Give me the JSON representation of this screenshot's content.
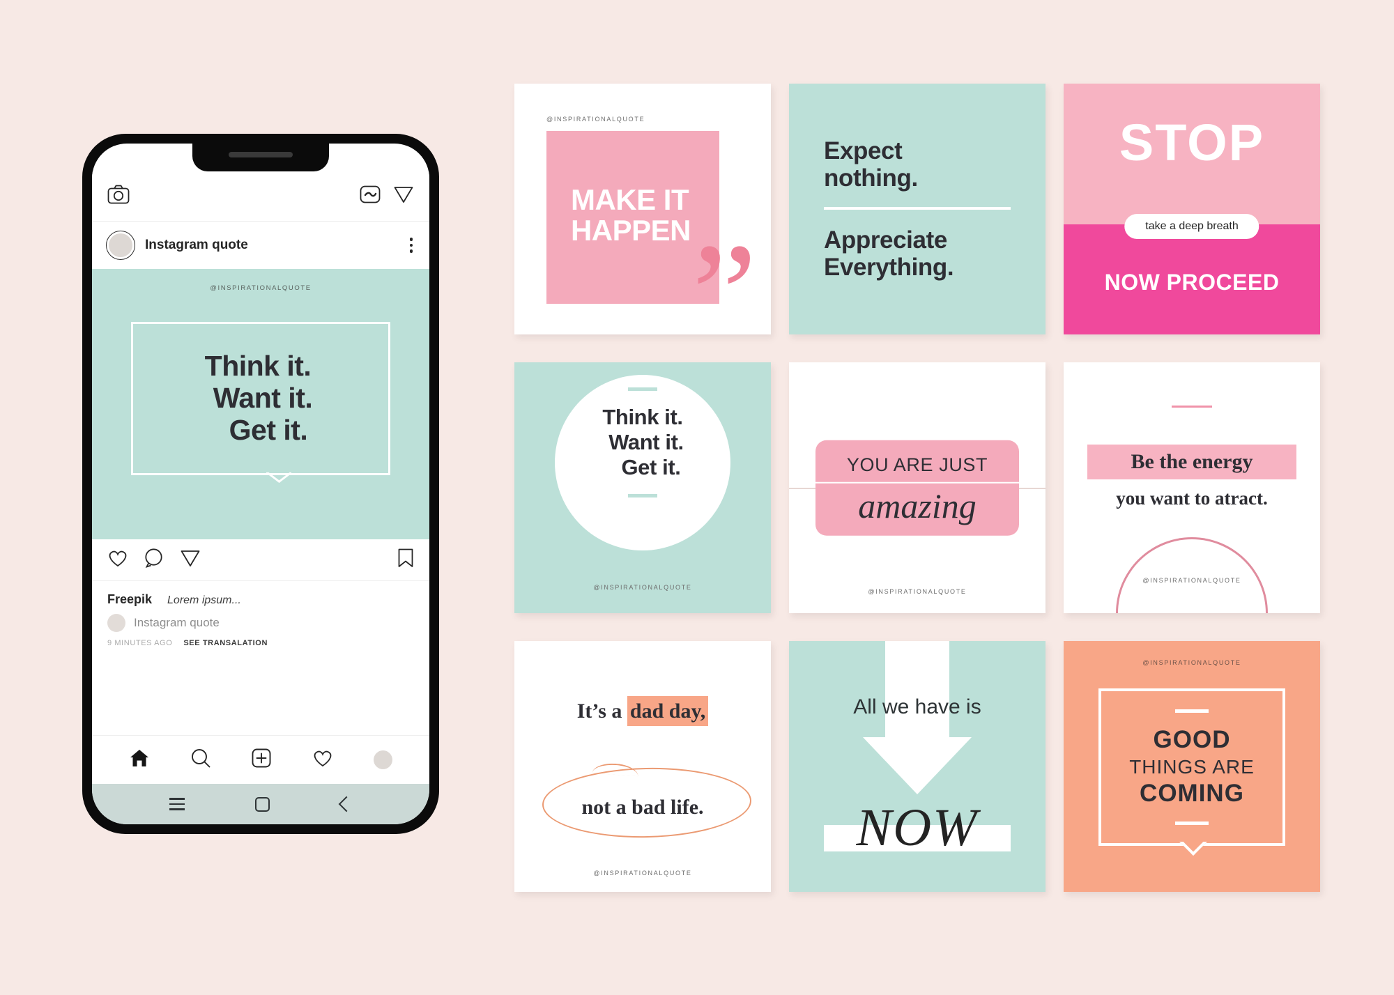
{
  "phone": {
    "topbar": {
      "camera_icon": "camera-icon",
      "igtv_icon": "igtv-icon",
      "send_icon": "send-icon"
    },
    "post_header": {
      "username": "Instagram quote",
      "more_icon": "more-options-icon"
    },
    "media": {
      "handle": "@INSPIRATIONALQUOTE",
      "quote_line1": "Think it.",
      "quote_line2": "Want it.",
      "quote_line3": "Get it.",
      "background_color": "#BCE0D8"
    },
    "actions": {
      "like_icon": "heart-icon",
      "comment_icon": "comment-icon",
      "share_icon": "share-icon",
      "save_icon": "bookmark-icon"
    },
    "caption": {
      "author": "Freepik",
      "text": "Lorem ipsum...",
      "comment_user": "Instagram quote",
      "timestamp": "9 MINUTES AGO",
      "translate_label": "SEE TRANSALATION"
    },
    "bottom_nav": [
      {
        "name": "home-icon"
      },
      {
        "name": "search-icon"
      },
      {
        "name": "add-post-icon"
      },
      {
        "name": "activity-heart-icon"
      },
      {
        "name": "profile-avatar"
      }
    ],
    "android_nav": [
      {
        "name": "menu-icon"
      },
      {
        "name": "home-square-icon"
      },
      {
        "name": "back-icon"
      }
    ]
  },
  "cards": [
    {
      "id": "make-it-happen",
      "handle": "@INSPIRATIONALQUOTE",
      "title_line1": "MAKE IT",
      "title_line2": "HAPPEN",
      "quote_glyph": "”",
      "bg": "#FFFFFF",
      "accent": "#F4AABB"
    },
    {
      "id": "expect-nothing",
      "line1": "Expect",
      "line2": "nothing.",
      "line3": "Appreciate",
      "line4": "Everything.",
      "bg": "#BCE0D8"
    },
    {
      "id": "stop-take-a-deep-breath",
      "headline": "STOP",
      "pill": "take a deep breath",
      "footer": "NOW PROCEED",
      "bg_top": "#F7B3C2",
      "bg_bottom": "#F0499C"
    },
    {
      "id": "think-it-circle",
      "line1": "Think it.",
      "line2": "Want it.",
      "line3": "Get it.",
      "handle": "@INSPIRATIONALQUOTE",
      "bg": "#BCE0D8"
    },
    {
      "id": "you-are-just-amazing",
      "top": "YOU ARE JUST",
      "bottom": "amazing",
      "handle": "@INSPIRATIONALQUOTE",
      "bg": "#FFFFFF",
      "accent": "#F4AABB"
    },
    {
      "id": "be-the-energy",
      "highlight": "Be the energy",
      "subtitle": "you want to atract.",
      "handle": "@INSPIRATIONALQUOTE",
      "bg": "#FFFFFF",
      "accent": "#F7B3C2"
    },
    {
      "id": "dad-day",
      "line1_a": "It’s a ",
      "line1_b": "dad day,",
      "line2": "not a bad life.",
      "handle": "@INSPIRATIONALQUOTE",
      "bg": "#FFFFFF",
      "accent": "#F8A687"
    },
    {
      "id": "all-we-have-is-now",
      "text": "All we have is",
      "emphasis": "NOW",
      "bg": "#BCE0D8"
    },
    {
      "id": "good-things-are-coming",
      "handle": "@INSPIRATIONALQUOTE",
      "line1": "GOOD",
      "line2": "THINGS ARE",
      "line3": "COMING",
      "bg": "#F8A687"
    }
  ]
}
